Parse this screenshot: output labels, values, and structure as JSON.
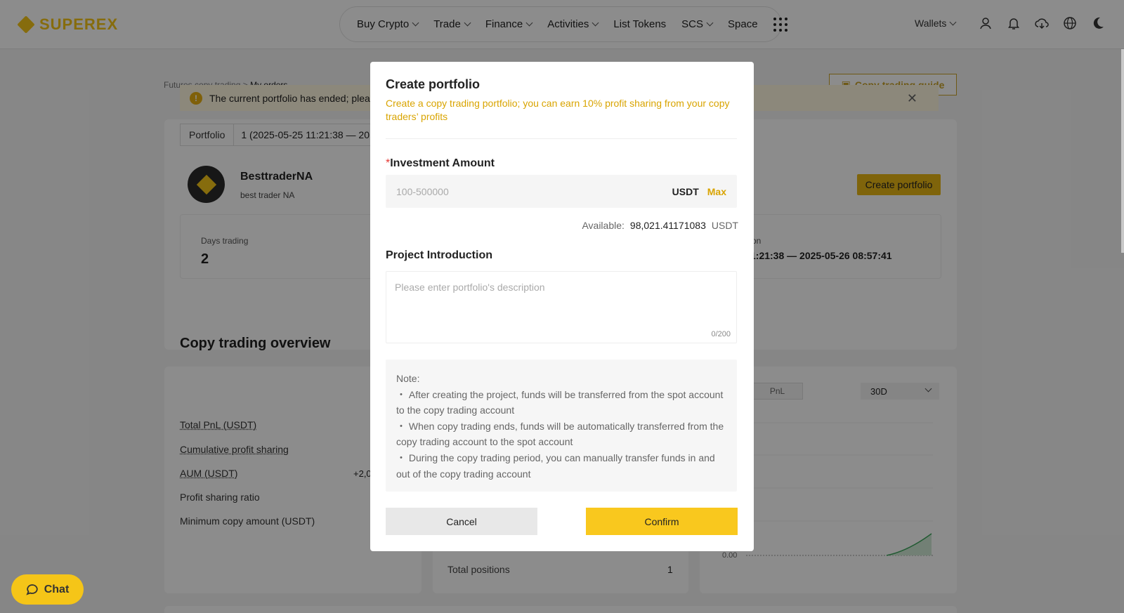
{
  "brand": {
    "name": "SUPEREX",
    "color": "#f5c518"
  },
  "nav": {
    "items": [
      {
        "label": "Buy Crypto",
        "dropdown": true
      },
      {
        "label": "Trade",
        "dropdown": true
      },
      {
        "label": "Finance",
        "dropdown": true
      },
      {
        "label": "Activities",
        "dropdown": true
      },
      {
        "label": "List Tokens",
        "dropdown": false
      },
      {
        "label": "SCS",
        "dropdown": true
      },
      {
        "label": "Space",
        "dropdown": false
      }
    ],
    "wallets_label": "Wallets"
  },
  "page": {
    "breadcrumb_parent": "Futures copy trading >",
    "breadcrumb_current": "My orders",
    "guide_label": "Copy trading guide",
    "alert_text": "The current portfolio has ended; pleas",
    "portfolio_label": "Portfolio",
    "portfolio_value": "1  (2025-05-25 11:21:38 — 20",
    "trader_name": "BesttraderNA",
    "trader_sub": "best trader NA",
    "create_portfolio_label": "Create portfolio",
    "days_trading_label": "Days trading",
    "days_trading_value": "2",
    "duration_label": "on",
    "duration_value": "1:21:38 — 2025-05-26 08:57:41",
    "overview_title": "Copy trading overview",
    "overview_rows": [
      "Total PnL (USDT)",
      "Cumulative profit sharing",
      "AUM (USDT)",
      "Profit sharing ratio",
      "Minimum copy amount (USDT)"
    ],
    "aum_value": "+2,0",
    "total_positions_label": "Total positions",
    "total_positions_value": "1",
    "pnl_tab": "PnL",
    "range_value": "30D",
    "chart_zero_label": "0.00"
  },
  "chat_label": "Chat",
  "modal": {
    "title": "Create portfolio",
    "subtitle": "Create a copy trading portfolio; you can earn 10% profit sharing from your copy traders’   profits",
    "investment_label": "Investment Amount",
    "required_mark": "*",
    "amount_placeholder": "100-500000",
    "amount_unit": "USDT",
    "max_label": "Max",
    "available_label": "Available:",
    "available_value": "98,021.41171083",
    "available_unit": "USDT",
    "intro_label": "Project Introduction",
    "intro_placeholder": "Please enter portfolio's description",
    "intro_count": "0/200",
    "note_title": "Note:",
    "notes": [
      "・ After creating the project, funds will be transferred from the spot account to the copy trading account",
      "・ When copy trading ends, funds will be automatically transferred from the copy trading account to the spot account",
      "・ During the copy trading period, you can manually transfer funds in and out of the copy trading account"
    ],
    "cancel_label": "Cancel",
    "confirm_label": "Confirm"
  },
  "icons": [
    "user-icon",
    "bell-icon",
    "download-icon",
    "globe-icon",
    "moon-icon",
    "apps-grid-icon",
    "chat-bubble-icon",
    "alert-icon",
    "close-icon",
    "guide-icon"
  ]
}
